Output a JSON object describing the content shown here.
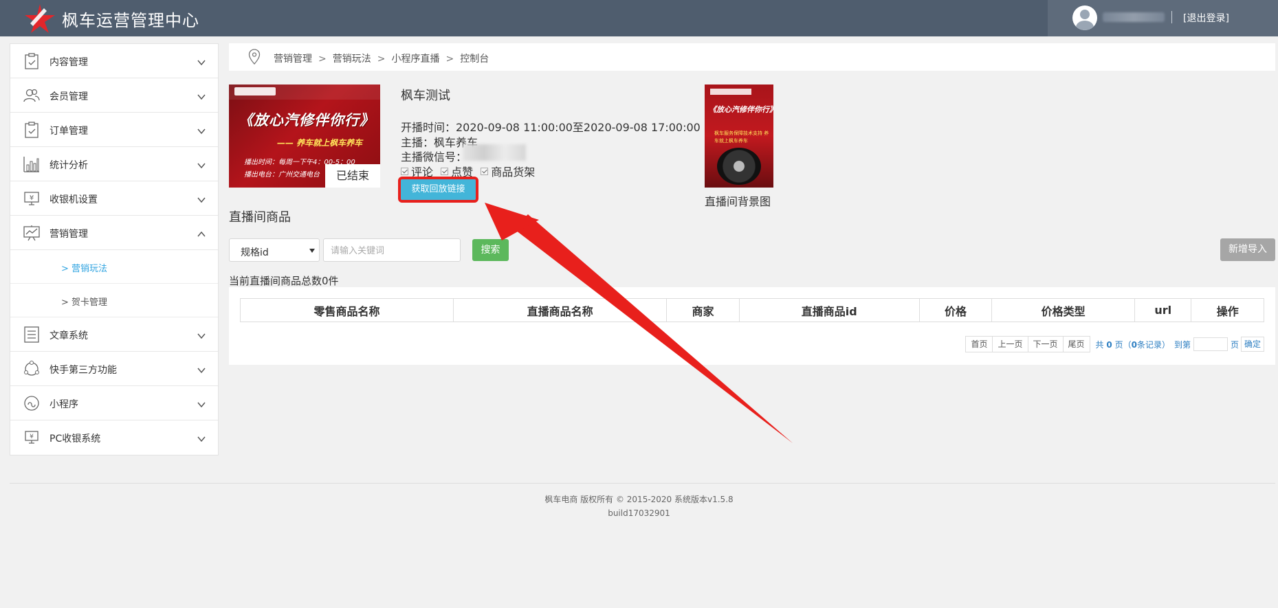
{
  "header": {
    "app_title": "枫车运营管理中心",
    "logout_label": "[退出登录]"
  },
  "sidebar": {
    "items": [
      {
        "label": "内容管理",
        "icon": "clipboard-icon"
      },
      {
        "label": "会员管理",
        "icon": "users-icon"
      },
      {
        "label": "订单管理",
        "icon": "clipboard-check-icon"
      },
      {
        "label": "统计分析",
        "icon": "bar-chart-icon"
      },
      {
        "label": "收银机设置",
        "icon": "cash-register-icon"
      },
      {
        "label": "营销管理",
        "icon": "trend-board-icon",
        "expanded": true
      },
      {
        "label": "文章系统",
        "icon": "list-icon"
      },
      {
        "label": "快手第三方功能",
        "icon": "cycle-icon"
      },
      {
        "label": "小程序",
        "icon": "miniprogram-icon"
      },
      {
        "label": "PC收银系统",
        "icon": "pc-cash-icon"
      }
    ],
    "subitems": [
      {
        "label": "> 营销玩法",
        "active": true
      },
      {
        "label": "> 贺卡管理",
        "active": false
      }
    ]
  },
  "breadcrumb": [
    "营销管理",
    "营销玩法",
    "小程序直播",
    "控制台"
  ],
  "breadcrumb_sep": ">",
  "live": {
    "cover": {
      "title": "《放心汽修伴你行》",
      "subtitle": "—— 养车就上枫车养车",
      "line1": "播出时间：每周一下午4：00-5：00",
      "line2": "播出电台：广州交通电台",
      "status": "已结束"
    },
    "title": "枫车测试",
    "time": "开播时间：2020-09-08 11:00:00至2020-09-08 17:00:00",
    "host": "主播：枫车养车",
    "wechat_label": "主播微信号：",
    "checks": [
      "评论",
      "点赞",
      "商品货架"
    ],
    "replay_button": "获取回放链接",
    "background": {
      "title": "《放心汽修伴你行》",
      "sub": "枫车服务保障技术支持 养车就上枫车养车",
      "caption": "直播间背景图"
    }
  },
  "goods": {
    "section_title": "直播间商品",
    "select_value": "规格id",
    "search_placeholder": "请输入关键词",
    "search_button": "搜索",
    "import_button": "新增导入",
    "total_text": "当前直播间商品总数0件",
    "columns": [
      "零售商品名称",
      "直播商品名称",
      "商家",
      "直播商品id",
      "价格",
      "价格类型",
      "url",
      "操作"
    ]
  },
  "pager": {
    "first": "首页",
    "prev": "上一页",
    "next": "下一页",
    "last": "尾页",
    "info_prefix": "共",
    "total_pages": "0",
    "info_mid": "页（",
    "total_records": "0",
    "info_suffix": "条记录）",
    "goto": "到第",
    "page": "页",
    "confirm": "确定"
  },
  "footer": {
    "copyright": "枫车电商 版权所有 © 2015-2020 系统版本v1.5.8",
    "build": "build17032901"
  },
  "colors": {
    "header_bg": "#4f5d6e",
    "accent_blue": "#43b5d9",
    "search_green": "#5cb85c",
    "annotation_red": "#e8201c",
    "link_blue": "#2e7fc2"
  }
}
